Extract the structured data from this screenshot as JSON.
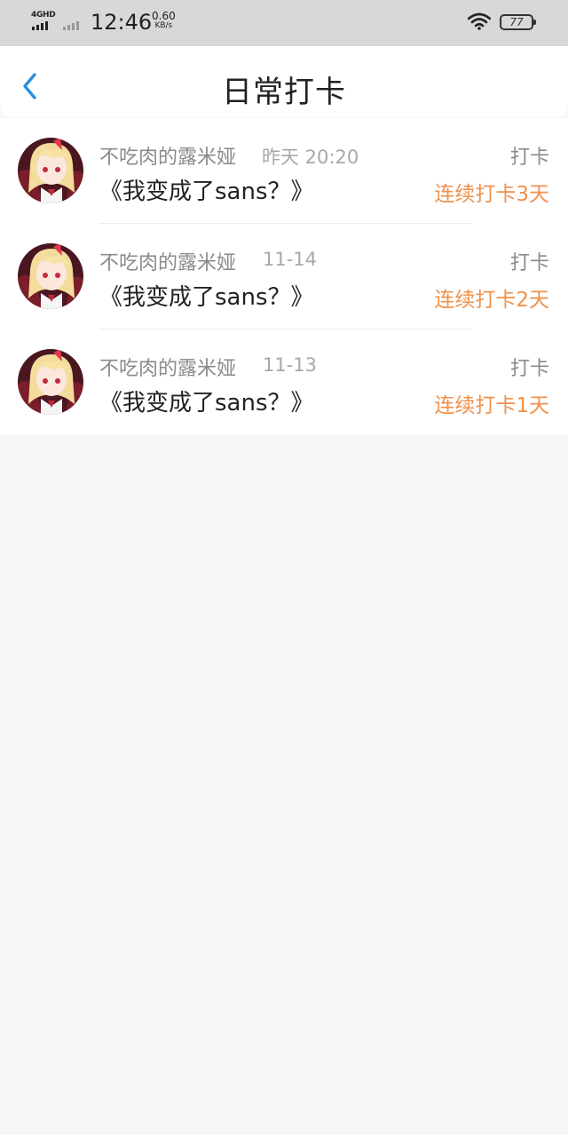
{
  "status_bar": {
    "network": "4GHD",
    "time": "12:46",
    "speed_value": "0.60",
    "speed_unit": "KB/s",
    "battery": "77",
    "icons": [
      "signal-icon",
      "wifi-icon",
      "battery-icon"
    ]
  },
  "header": {
    "title": "日常打卡",
    "back_icon": "chevron-left-icon",
    "accent_color": "#2a8fe0"
  },
  "checkins": [
    {
      "user": "不吃肉的露米娅",
      "date": "昨天 20:20",
      "action": "打卡",
      "book": "《我变成了sans？》",
      "streak": "连续打卡3天"
    },
    {
      "user": "不吃肉的露米娅",
      "date": "11-14",
      "action": "打卡",
      "book": "《我变成了sans？》",
      "streak": "连续打卡2天"
    },
    {
      "user": "不吃肉的露米娅",
      "date": "11-13",
      "action": "打卡",
      "book": "《我变成了sans？》",
      "streak": "连续打卡1天"
    }
  ],
  "colors": {
    "streak": "#f0914b",
    "muted_text": "#8a8a8a",
    "primary_text": "#222222",
    "background": "#f8f7f8"
  }
}
